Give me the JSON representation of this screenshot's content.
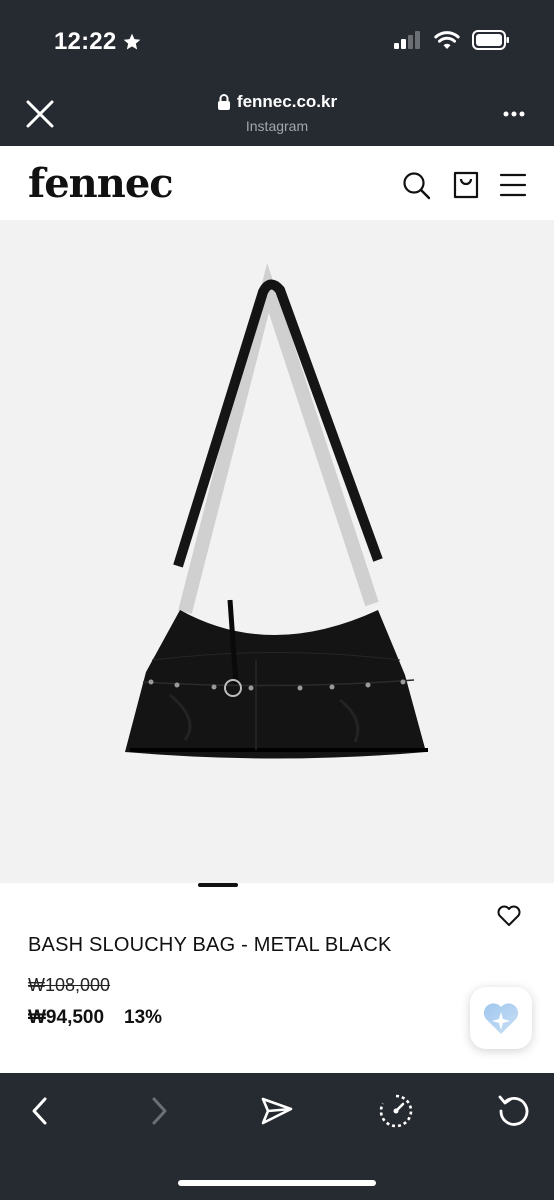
{
  "status_bar": {
    "time": "12:22",
    "icons": [
      "star-icon",
      "signal-icon",
      "wifi-icon",
      "battery-icon"
    ]
  },
  "browser": {
    "url": "fennec.co.kr",
    "source": "Instagram",
    "icons": [
      "close-icon",
      "lock-icon",
      "more-icon"
    ]
  },
  "site": {
    "logo": "fennec",
    "icons": [
      "search-icon",
      "shopping-bag-icon",
      "menu-icon"
    ]
  },
  "product": {
    "image_alt_icon": "shoulder-bag-image",
    "name": "BASH SLOUCHY BAG - METAL BLACK",
    "original_price": "₩108,000",
    "sale_price": "₩94,500",
    "discount": "13%",
    "carousel_total_indicators": 1
  },
  "toolbar": {
    "icons": [
      "back-icon",
      "forward-icon",
      "share-icon",
      "speed-icon",
      "reload-icon"
    ]
  },
  "colors": {
    "chrome": "#262a31",
    "page_bg": "#ffffff",
    "image_bg": "#f2f2f2",
    "text": "#111111",
    "muted": "#a3a6ab"
  }
}
